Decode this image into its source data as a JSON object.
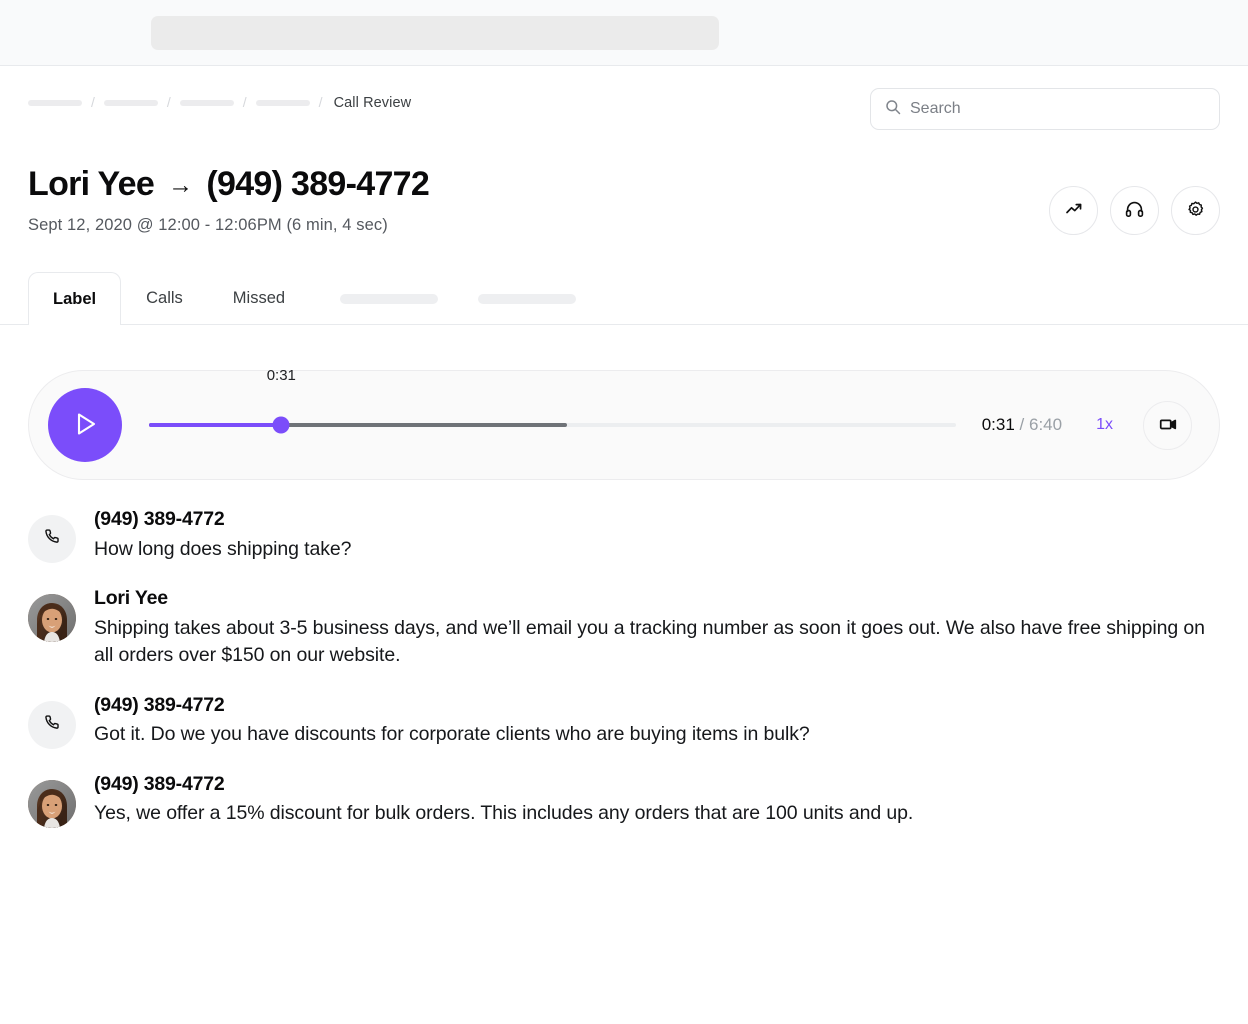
{
  "browser": {
    "url_bar_placeholder": ""
  },
  "breadcrumb": {
    "skeleton_count": 4,
    "separator": "/",
    "current": "Call Review"
  },
  "search": {
    "placeholder": "Search",
    "value": "",
    "icon": "search-icon"
  },
  "header": {
    "caller": "Lori Yee",
    "arrow": "→",
    "callee": "(949) 389-4772",
    "subtitle": "Sept 12, 2020 @ 12:00 - 12:06PM (6 min, 4 sec)",
    "actions": [
      {
        "name": "analytics-button",
        "icon": "trending-up-icon"
      },
      {
        "name": "listen-button",
        "icon": "headphones-icon"
      },
      {
        "name": "settings-button",
        "icon": "gear-icon"
      }
    ]
  },
  "tabs": [
    {
      "label": "Label",
      "active": true
    },
    {
      "label": "Calls",
      "active": false
    },
    {
      "label": "Missed",
      "active": false
    }
  ],
  "tab_skeletons": 2,
  "player": {
    "play_icon": "play-icon",
    "current_time": "0:31",
    "thumb_label": "0:31",
    "total_time": "6:40",
    "time_separator": "/",
    "speed": "1x",
    "video_icon": "video-camera-icon",
    "progress_percent": 16.4,
    "buffered_percent": 51.8,
    "accent_color": "#7b4dfa",
    "buffered_color": "#6f7378",
    "track_color": "#eceef0"
  },
  "transcript": [
    {
      "speaker": "(949) 389-4772",
      "text": "How long does shipping take?",
      "avatar": "phone-icon"
    },
    {
      "speaker": "Lori Yee",
      "text": "Shipping takes about 3-5 business days, and we’ll email you a tracking number as soon it goes out. We also have free shipping on all orders over $150 on our website.",
      "avatar": "photo"
    },
    {
      "speaker": "(949) 389-4772",
      "text": "Got it. Do we you have discounts for corporate clients who are buying items in bulk?",
      "avatar": "phone-icon"
    },
    {
      "speaker": "(949) 389-4772",
      "text": "Yes, we offer a 15% discount for bulk orders. This includes any orders that are 100 units and up.",
      "avatar": "photo"
    }
  ]
}
